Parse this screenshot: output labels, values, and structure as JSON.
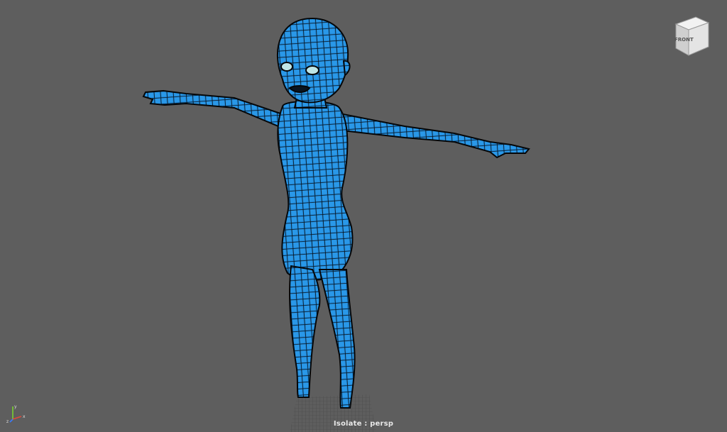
{
  "viewport": {
    "camera_label": "Isolate : persp",
    "background_color": "#5e5e5e",
    "mesh_color": "#1f86d6",
    "wire_color": "#0a0f14"
  },
  "view_cube": {
    "face_label": "FRONT",
    "icon": "view-cube-icon"
  },
  "axis_gizmo": {
    "icon": "axis-gizmo-icon",
    "x_label": "x",
    "y_label": "y",
    "z_label": "z"
  }
}
